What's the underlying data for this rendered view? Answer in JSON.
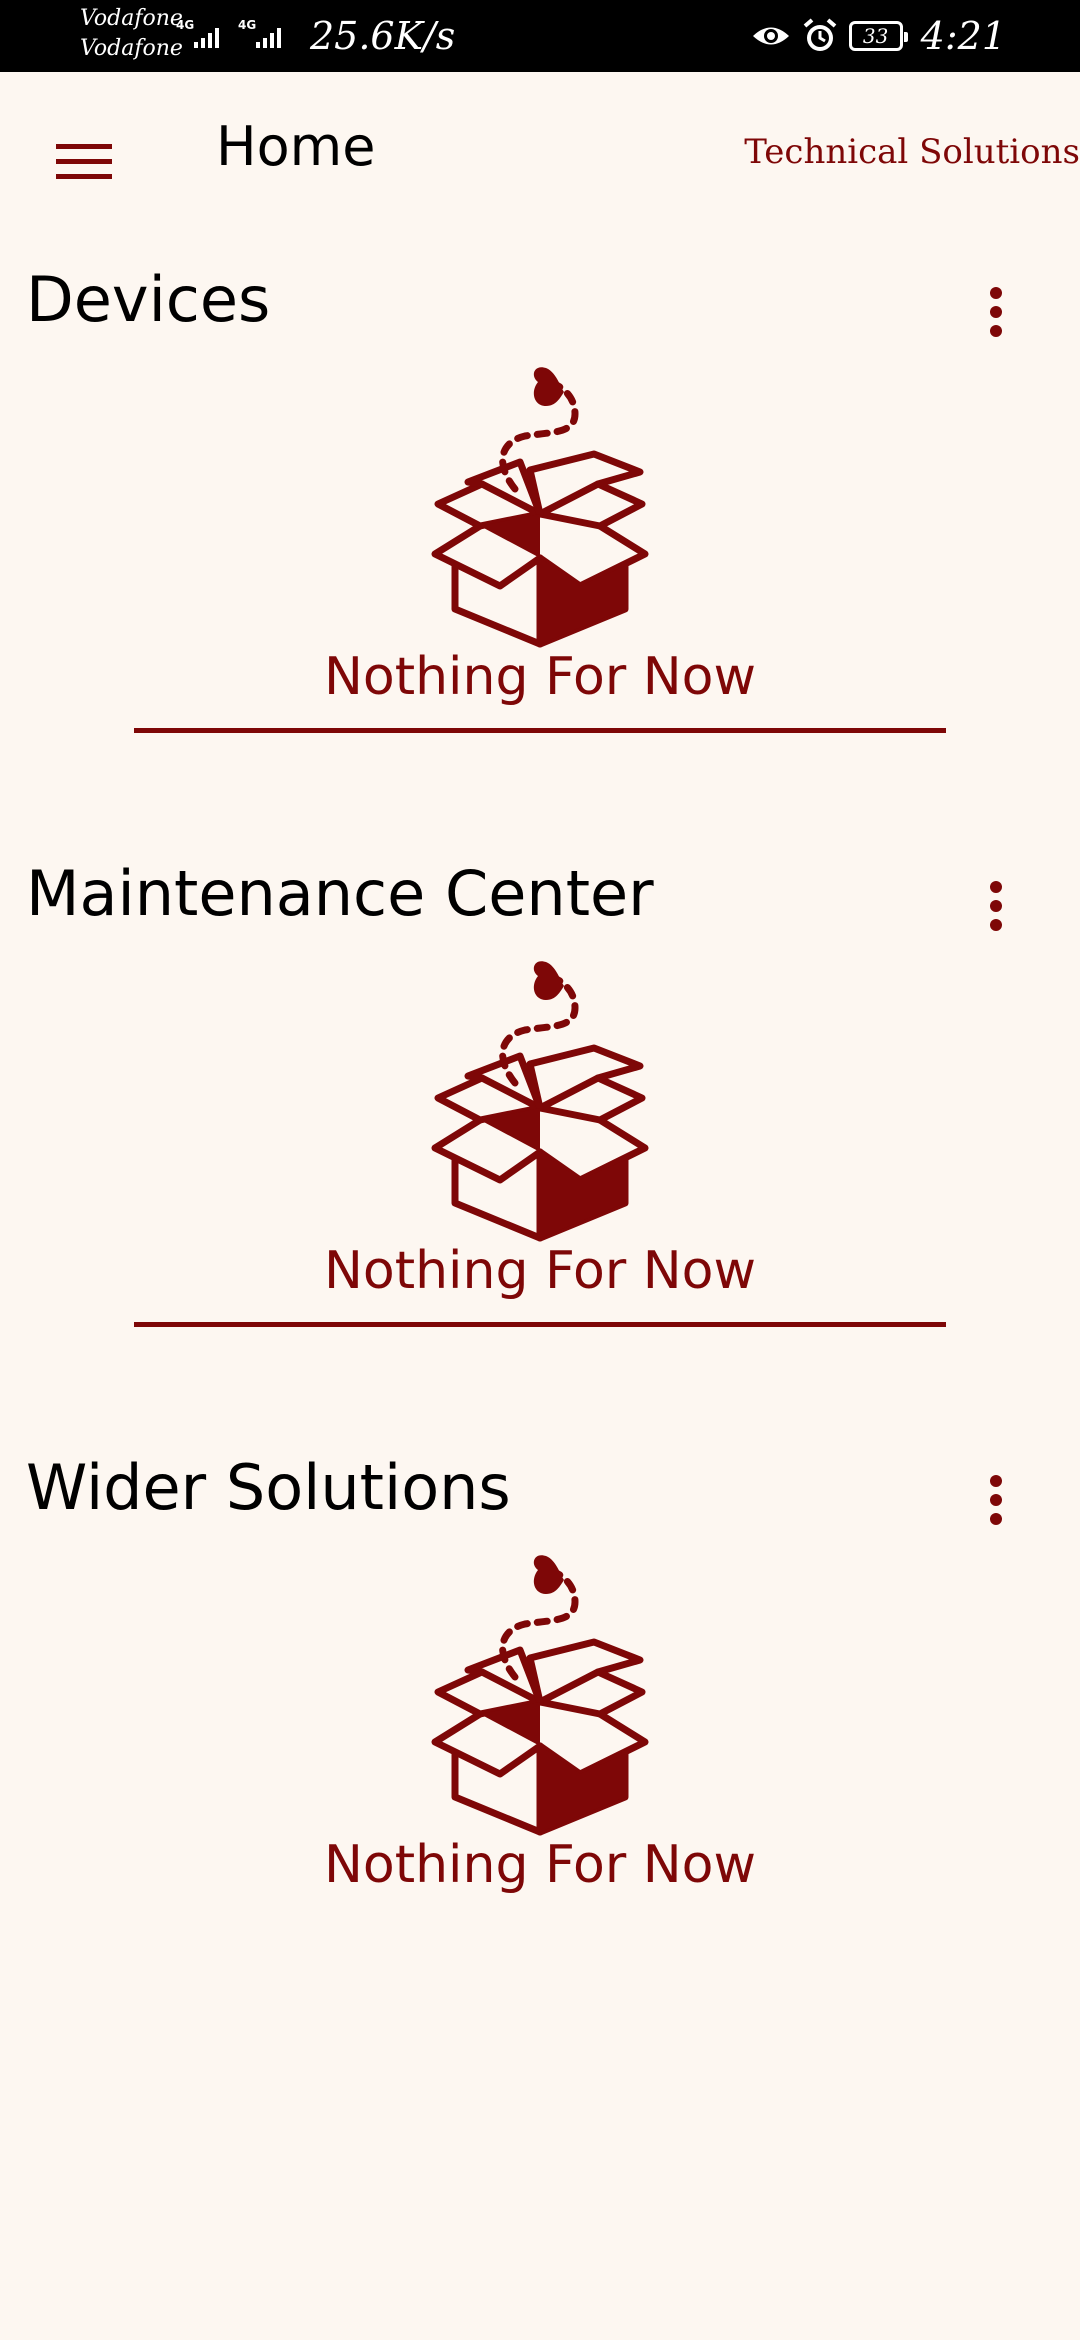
{
  "status_bar": {
    "carrier_1": "Vodafone",
    "carrier_2": "Vodafone",
    "network_1": "4G",
    "network_2": "4G",
    "speed": "25.6K/s",
    "battery": "33",
    "time": "4:21"
  },
  "app_bar": {
    "title": "Home",
    "brand": "Technical Solutions",
    "menu_icon": "hamburger-menu-icon"
  },
  "colors": {
    "accent": "#7e0707",
    "background": "#fdf7f1",
    "status_bar": "#000000",
    "text": "#000000"
  },
  "sections": [
    {
      "title": "Devices",
      "empty_text": "Nothing For Now",
      "icon": "open-box-icon",
      "more_icon": "more-vert-icon",
      "has_divider": true
    },
    {
      "title": "Maintenance Center",
      "empty_text": "Nothing For Now",
      "icon": "open-box-icon",
      "more_icon": "more-vert-icon",
      "has_divider": true
    },
    {
      "title": "Wider Solutions",
      "empty_text": "Nothing For Now",
      "icon": "open-box-icon",
      "more_icon": "more-vert-icon",
      "has_divider": false
    }
  ]
}
